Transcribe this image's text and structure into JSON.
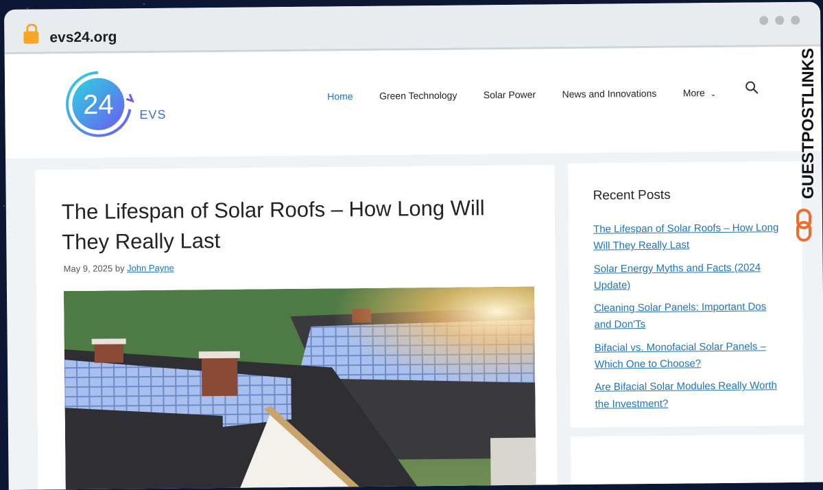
{
  "browser": {
    "url": "evs24.org"
  },
  "logo": {
    "number": "24",
    "brand": "EVS"
  },
  "nav": {
    "items": [
      "Home",
      "Green Technology",
      "Solar Power",
      "News and Innovations"
    ],
    "more_label": "More"
  },
  "post": {
    "title": "The Lifespan of Solar Roofs – How Long Will They Really Last",
    "date": "May 9, 2025",
    "by": "by",
    "author": "John Payne"
  },
  "sidebar": {
    "title": "Recent Posts",
    "posts": [
      "The Lifespan of Solar Roofs – How Long Will They Really Last",
      "Solar Energy Myths and Facts (2024 Update)",
      "Cleaning Solar Panels: Important Dos and Don'Ts",
      "Bifacial vs. Monofacial Solar Panels – Which One to Choose?",
      "Are Bifacial Solar Modules Really Worth the Investment?"
    ]
  },
  "watermark": {
    "text": "GUESTPOSTLINKS"
  },
  "colors": {
    "link": "#1e73be",
    "accent_orange": "#f26b2a",
    "lock": "#f5a623"
  }
}
